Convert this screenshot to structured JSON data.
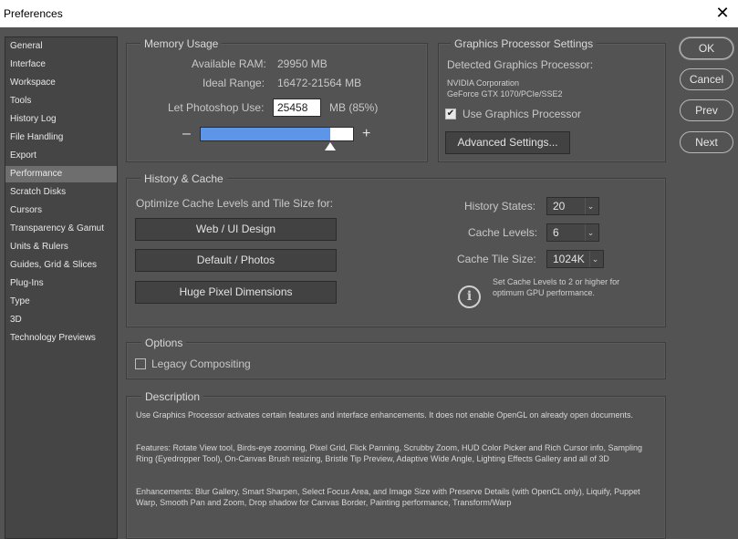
{
  "window": {
    "title": "Preferences",
    "close_glyph": "✕"
  },
  "sidebar": {
    "items": [
      {
        "label": "General"
      },
      {
        "label": "Interface"
      },
      {
        "label": "Workspace"
      },
      {
        "label": "Tools"
      },
      {
        "label": "History Log"
      },
      {
        "label": "File Handling"
      },
      {
        "label": "Export"
      },
      {
        "label": "Performance",
        "active": true
      },
      {
        "label": "Scratch Disks"
      },
      {
        "label": "Cursors"
      },
      {
        "label": "Transparency & Gamut"
      },
      {
        "label": "Units & Rulers"
      },
      {
        "label": "Guides, Grid & Slices"
      },
      {
        "label": "Plug-Ins"
      },
      {
        "label": "Type"
      },
      {
        "label": "3D"
      },
      {
        "label": "Technology Previews"
      }
    ]
  },
  "memory": {
    "legend": "Memory Usage",
    "available_label": "Available RAM:",
    "available_value": "29950 MB",
    "ideal_label": "Ideal Range:",
    "ideal_value": "16472-21564 MB",
    "let_label": "Let Photoshop Use:",
    "let_value": "25458",
    "let_suffix": "MB (85%)",
    "minus": "–",
    "plus": "+",
    "slider_fraction": 0.85
  },
  "gpu": {
    "legend": "Graphics Processor Settings",
    "detected_label": "Detected Graphics Processor:",
    "vendor": "NVIDIA Corporation",
    "model": "GeForce GTX 1070/PCIe/SSE2",
    "use_label": "Use Graphics Processor",
    "use_checked": true,
    "advanced_button": "Advanced Settings..."
  },
  "history": {
    "legend": "History & Cache",
    "optimize_label": "Optimize Cache Levels and Tile Size for:",
    "buttons": [
      "Web / UI Design",
      "Default / Photos",
      "Huge Pixel Dimensions"
    ],
    "history_states_label": "History States:",
    "history_states_value": "20",
    "cache_levels_label": "Cache Levels:",
    "cache_levels_value": "6",
    "tile_size_label": "Cache Tile Size:",
    "tile_size_value": "1024K",
    "info_text_1": "Set Cache Levels to 2 or higher for",
    "info_text_2": "optimum GPU performance.",
    "info_icon_glyph": "i"
  },
  "options": {
    "legend": "Options",
    "legacy_label": "Legacy Compositing",
    "legacy_checked": false
  },
  "description": {
    "legend": "Description",
    "p1": "Use Graphics Processor activates certain features and interface enhancements. It does not enable OpenGL on already open documents.",
    "p2": "Features: Rotate View tool, Birds-eye zooming, Pixel Grid, Flick Panning, Scrubby Zoom, HUD Color Picker and Rich Cursor info, Sampling Ring (Eyedropper Tool), On-Canvas Brush resizing, Bristle Tip Preview, Adaptive Wide Angle, Lighting Effects Gallery and all of 3D",
    "p3": "Enhancements: Blur Gallery, Smart Sharpen, Select Focus Area, and Image Size with Preserve Details (with OpenCL only), Liquify, Puppet Warp, Smooth Pan and Zoom, Drop shadow for Canvas Border, Painting performance, Transform/Warp"
  },
  "actions": {
    "ok": "OK",
    "cancel": "Cancel",
    "prev": "Prev",
    "next": "Next"
  },
  "icons": {
    "checkmark": "✔",
    "caret": "⌄"
  },
  "colors": {
    "background": "#535353",
    "sidebar_bg": "#454545",
    "active_item": "#6e6e6e",
    "slider_fill": "#5d96e8"
  }
}
